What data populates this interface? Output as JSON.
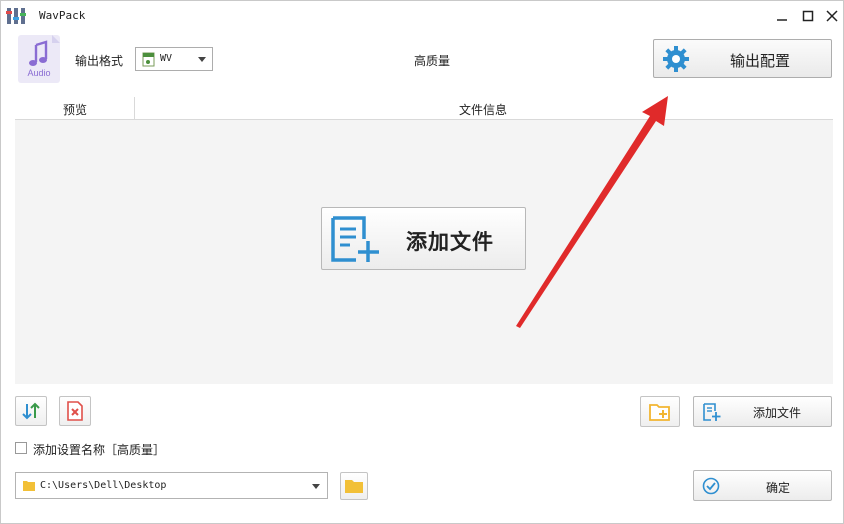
{
  "window": {
    "title": "WavPack"
  },
  "toolbar": {
    "audio_tile_label": "Audio",
    "format_label": "输出格式",
    "format_value": "WV",
    "quality_text": "高质量",
    "config_button_label": "输出配置"
  },
  "file_table": {
    "columns": [
      "预览",
      "文件信息"
    ],
    "add_files_big_label": "添加文件"
  },
  "bottom": {
    "add_files_label": "添加文件",
    "add_setting_name_label": "添加设置名称［高质量］",
    "add_setting_name_checked": false,
    "output_path": "C:\\Users\\Dell\\Desktop",
    "ok_label": "确定"
  },
  "colors": {
    "accent_blue": "#2f8fd0",
    "folder_yellow": "#f2c037",
    "delete_red": "#e0504a",
    "annotation_red": "#e02a2a"
  },
  "icons": [
    "app-icon",
    "minimize-icon",
    "maximize-icon",
    "close-icon",
    "audio-note-icon",
    "wv-file-icon",
    "gear-icon",
    "add-file-icon",
    "sort-icon",
    "delete-icon",
    "add-folder-icon",
    "folder-icon",
    "check-circle-icon"
  ]
}
